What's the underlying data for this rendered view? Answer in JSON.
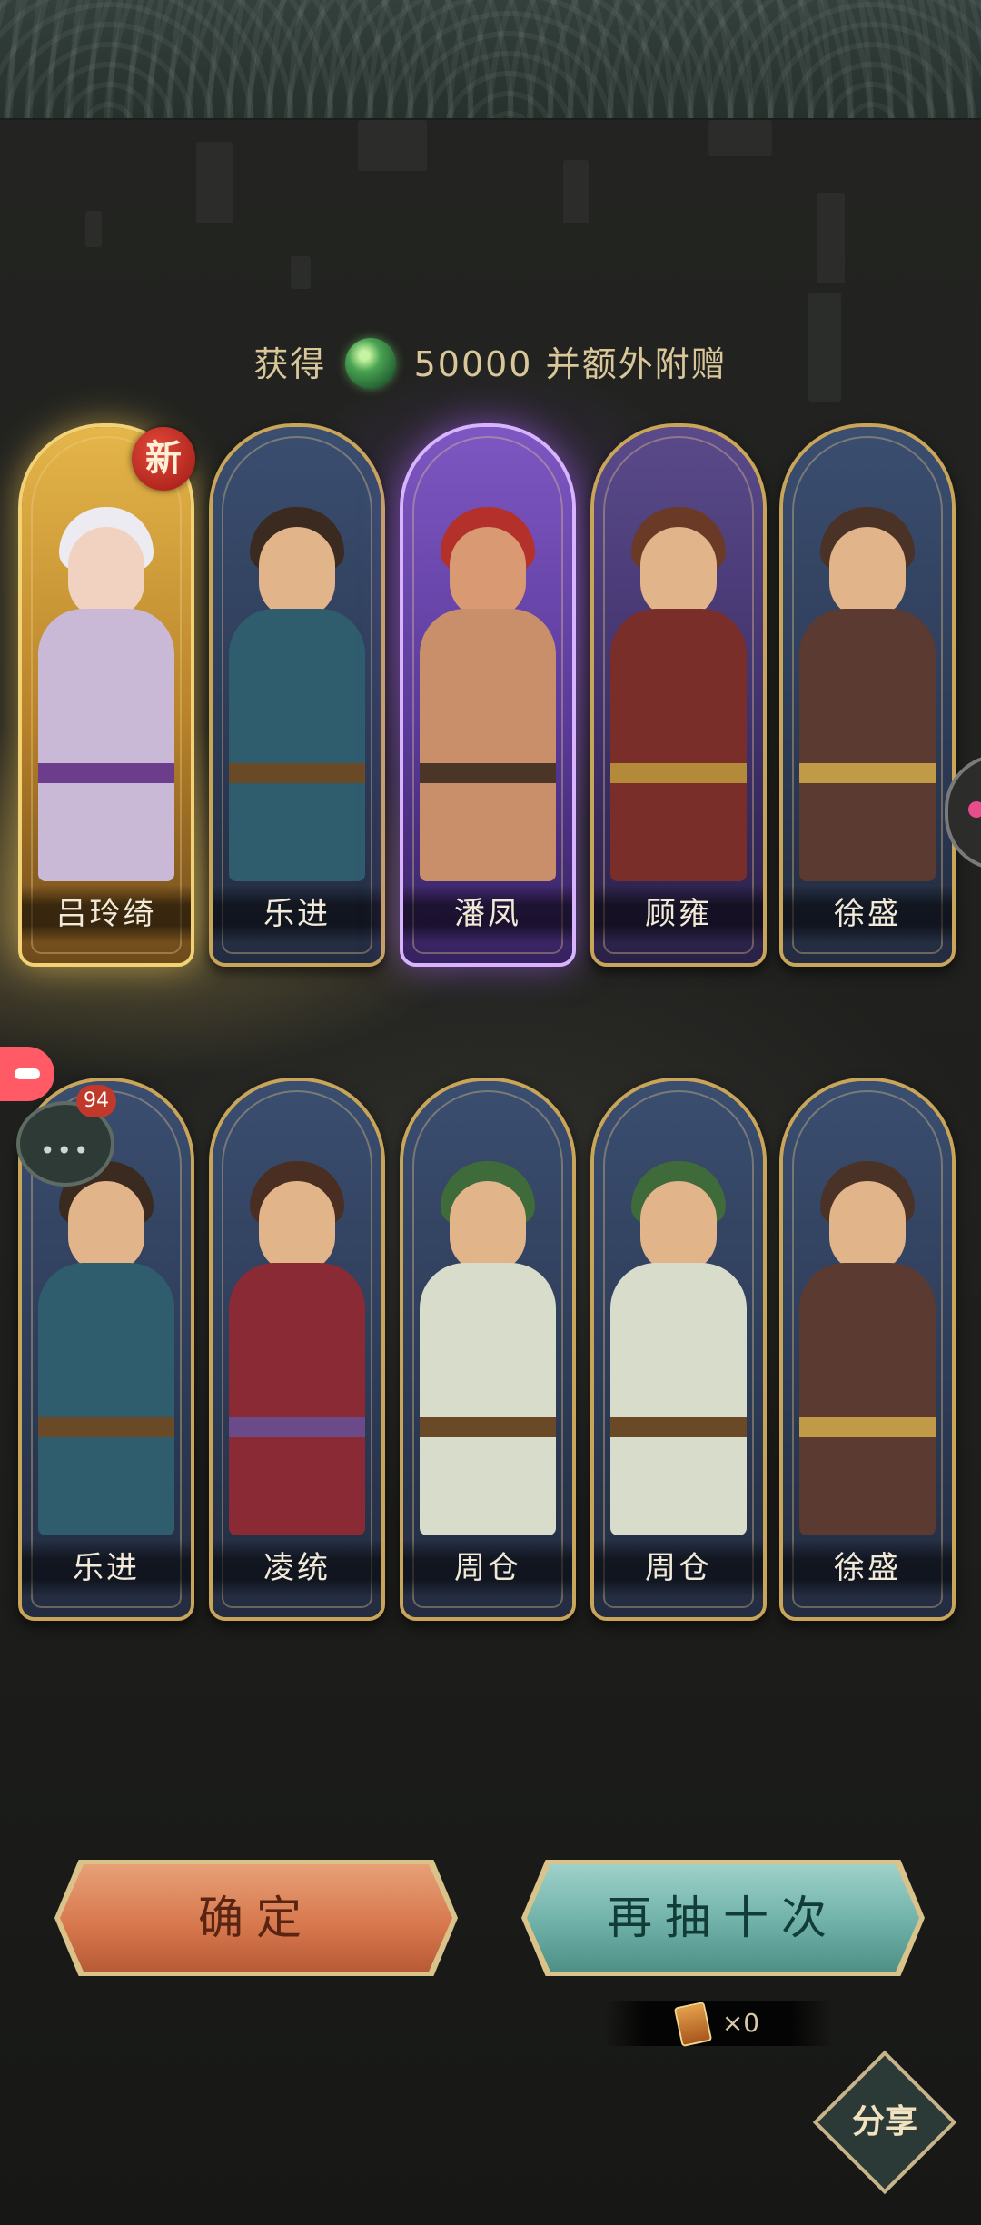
{
  "reward": {
    "prefix": "获得",
    "amount": "50000",
    "suffix": "并额外附赠",
    "item_icon": "jade-orb-icon"
  },
  "cards": [
    {
      "name": "吕玲绮",
      "rarity": "gold",
      "is_new": true,
      "new_label": "新"
    },
    {
      "name": "乐进",
      "rarity": "blue"
    },
    {
      "name": "潘凤",
      "rarity": "purple"
    },
    {
      "name": "顾雍",
      "rarity": "blue"
    },
    {
      "name": "徐盛",
      "rarity": "blue"
    },
    {
      "name": "乐进",
      "rarity": "blue"
    },
    {
      "name": "凌统",
      "rarity": "blue"
    },
    {
      "name": "周仓",
      "rarity": "blue"
    },
    {
      "name": "周仓",
      "rarity": "blue"
    },
    {
      "name": "徐盛",
      "rarity": "blue"
    }
  ],
  "buttons": {
    "confirm": "确定",
    "retry": "再抽十次",
    "share": "分享"
  },
  "ticket": {
    "icon": "draw-ticket-icon",
    "count": "×0"
  },
  "messages": {
    "badge": "94"
  },
  "colors": {
    "gold_glow": "#f3d276",
    "purple_glow": "#d8b4ff",
    "confirm": "#d8794f",
    "retry": "#6fb1a8"
  }
}
